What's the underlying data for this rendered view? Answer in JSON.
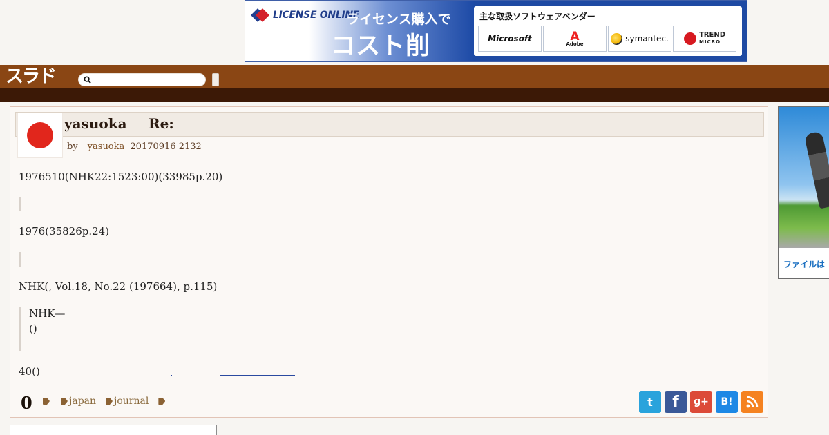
{
  "ad_banner": {
    "logo_text": "LICENSE ONLINE",
    "copy_line1": "ライセンス購入で",
    "copy_line2": "コスト削減！",
    "vendors_title": "主な取扱ソフトウェアベンダー",
    "vendors": {
      "microsoft": "Microsoft",
      "adobe_mark": "A",
      "adobe": "Adobe",
      "symantec": "symantec.",
      "trend_line1": "TREND",
      "trend_line2": "MICRO"
    }
  },
  "header": {
    "logo": "スラド",
    "search": {
      "value": "",
      "placeholder": ""
    }
  },
  "article": {
    "author": "yasuoka",
    "title": "Re:",
    "byline_by": "by",
    "byline_author": "yasuoka",
    "byline_datetime": "20170916 2132",
    "paragraphs": [
      "1976510(NHK22:1523:00)(33985p.20)",
      "1976(35826p.24)",
      "NHK(, Vol.18, No.22 (197664), p.115)",
      "40()"
    ],
    "quote_lines": [
      "NHK—",
      "()"
    ],
    "score": "0",
    "tags": [
      "",
      "japan",
      "journal",
      ""
    ]
  },
  "share_icons": [
    "twitter-icon",
    "facebook-icon",
    "google-plus-icon",
    "hatena-bookmark-icon",
    "rss-icon"
  ],
  "share_glyphs": {
    "twitter": "t",
    "facebook": "f",
    "gplus": "g+",
    "hatena": "B!",
    "rss": ""
  },
  "side_ad": {
    "text": "ファイルは"
  },
  "colors": {
    "header": "#8a4614",
    "header_dark": "#3c1906",
    "accent_red": "#e1261c",
    "tag": "#8a6a3d"
  }
}
